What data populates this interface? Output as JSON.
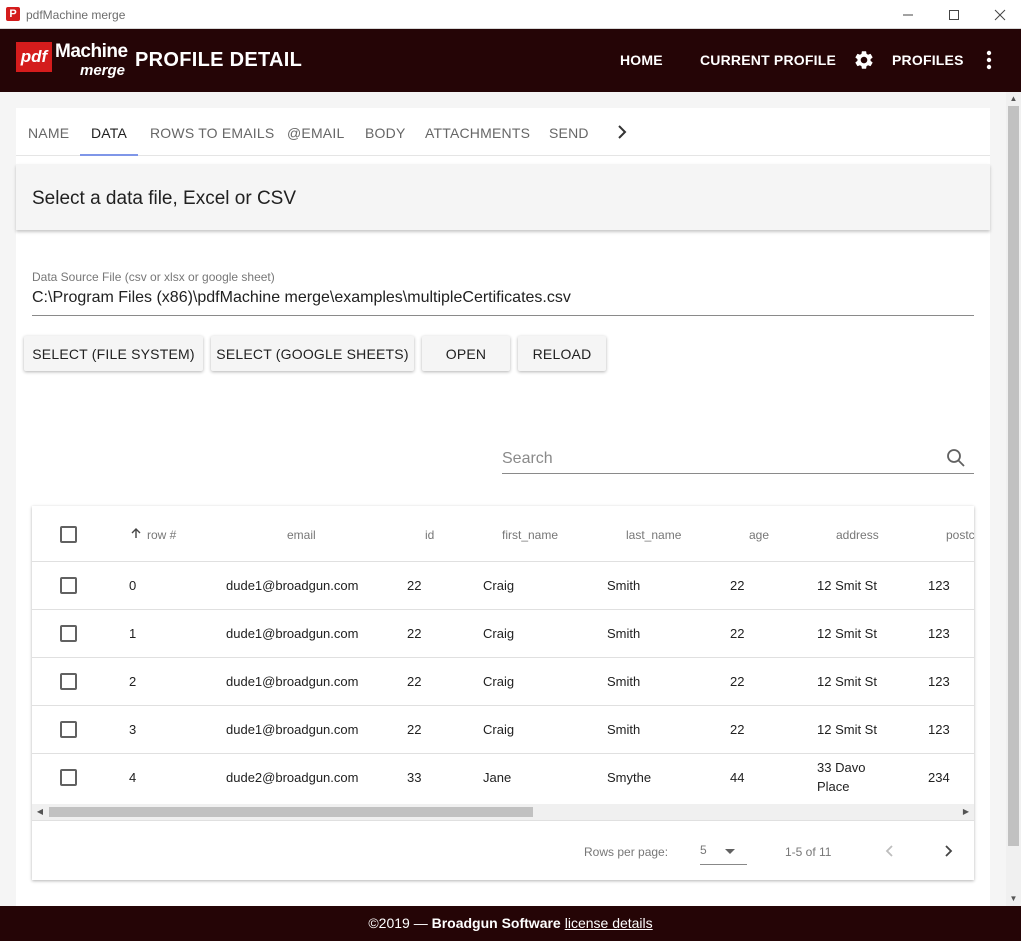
{
  "window": {
    "title": "pdfMachine merge",
    "icon_glyph": "P"
  },
  "appbar": {
    "logo_pdf": "pdf",
    "logo_machine": "Machine",
    "logo_merge": "merge",
    "title": "PROFILE DETAIL",
    "nav": {
      "home": "HOME",
      "current_profile": "CURRENT PROFILE",
      "profiles": "PROFILES"
    },
    "colors": {
      "bar": "#250506",
      "logo_red": "#d41c1c"
    }
  },
  "tabs": [
    "NAME",
    "DATA",
    "ROWS TO EMAILS",
    "@EMAIL",
    "BODY",
    "ATTACHMENTS",
    "SEND"
  ],
  "active_tab": "DATA",
  "section": {
    "heading": "Select a data file, Excel or CSV"
  },
  "datasource": {
    "label": "Data Source File (csv or xlsx or google sheet)",
    "value": "C:\\Program Files (x86)\\pdfMachine merge\\examples\\multipleCertificates.csv"
  },
  "buttons": {
    "select_fs": "SELECT (FILE SYSTEM)",
    "select_gs": "SELECT (GOOGLE SHEETS)",
    "open": "OPEN",
    "reload": "RELOAD"
  },
  "search": {
    "placeholder": "Search"
  },
  "table": {
    "columns": [
      "row #",
      "email",
      "id",
      "first_name",
      "last_name",
      "age",
      "address",
      "postc"
    ],
    "rows": [
      {
        "row": "0",
        "email": "dude1@broadgun.com",
        "id": "22",
        "first_name": "Craig",
        "last_name": "Smith",
        "age": "22",
        "address": "12 Smit St",
        "address2": "",
        "postcode": "123"
      },
      {
        "row": "1",
        "email": "dude1@broadgun.com",
        "id": "22",
        "first_name": "Craig",
        "last_name": "Smith",
        "age": "22",
        "address": "12 Smit St",
        "address2": "",
        "postcode": "123"
      },
      {
        "row": "2",
        "email": "dude1@broadgun.com",
        "id": "22",
        "first_name": "Craig",
        "last_name": "Smith",
        "age": "22",
        "address": "12 Smit St",
        "address2": "",
        "postcode": "123"
      },
      {
        "row": "3",
        "email": "dude1@broadgun.com",
        "id": "22",
        "first_name": "Craig",
        "last_name": "Smith",
        "age": "22",
        "address": "12 Smit St",
        "address2": "",
        "postcode": "123"
      },
      {
        "row": "4",
        "email": "dude2@broadgun.com",
        "id": "33",
        "first_name": "Jane",
        "last_name": "Smythe",
        "age": "44",
        "address": "33 Davo",
        "address2": "Place",
        "postcode": "234"
      }
    ]
  },
  "pagination": {
    "rows_per_page_label": "Rows per page:",
    "rows_per_page": "5",
    "range": "1-5 of 11"
  },
  "footer": {
    "copyright": "©2019 — ",
    "company": "Broadgun Software",
    "link": "license details"
  }
}
